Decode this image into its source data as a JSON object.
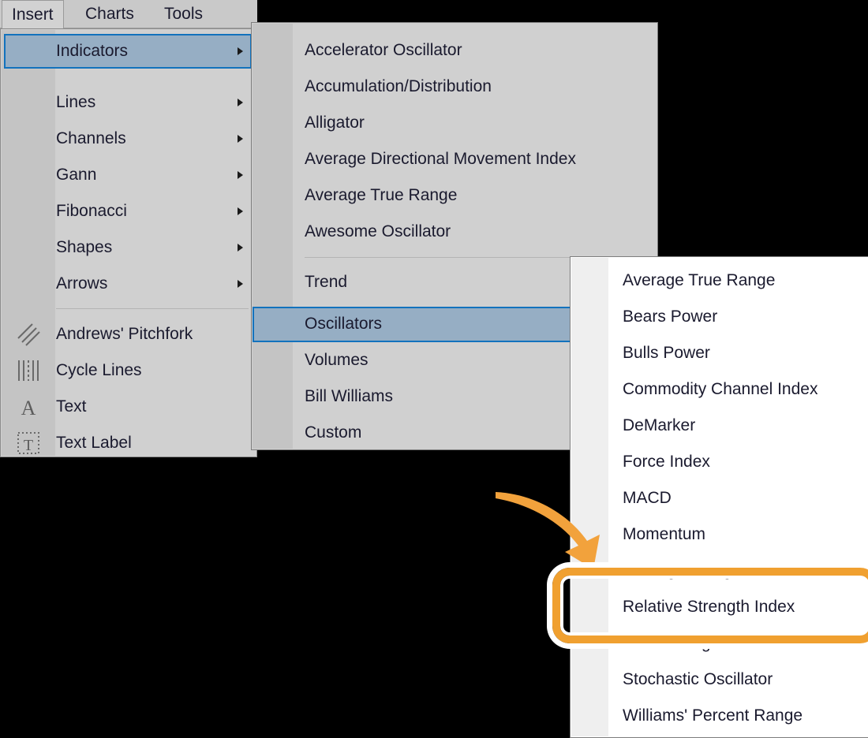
{
  "menubar": {
    "tabs": [
      {
        "label": "Insert",
        "active": true
      },
      {
        "label": "Charts",
        "active": false
      },
      {
        "label": "Tools",
        "active": false
      }
    ]
  },
  "panel_insert": {
    "highlighted_item": "Indicators",
    "items": [
      {
        "label": "Indicators",
        "has_submenu": true,
        "highlighted": true
      },
      {
        "label": "Lines",
        "has_submenu": true
      },
      {
        "label": "Channels",
        "has_submenu": true
      },
      {
        "label": "Gann",
        "has_submenu": true
      },
      {
        "label": "Fibonacci",
        "has_submenu": true
      },
      {
        "label": "Shapes",
        "has_submenu": true
      },
      {
        "label": "Arrows",
        "has_submenu": true
      },
      {
        "label": "Andrews' Pitchfork",
        "icon": "pitchfork-icon"
      },
      {
        "label": "Cycle Lines",
        "icon": "cycle-lines-icon"
      },
      {
        "label": "Text",
        "icon": "text-a-icon"
      },
      {
        "label": "Text Label",
        "icon": "text-label-icon"
      }
    ]
  },
  "panel_indicators": {
    "highlighted_item": "Oscillators",
    "items": [
      {
        "label": "Accelerator Oscillator"
      },
      {
        "label": "Accumulation/Distribution"
      },
      {
        "label": "Alligator"
      },
      {
        "label": "Average Directional Movement Index"
      },
      {
        "label": "Average True Range"
      },
      {
        "label": "Awesome Oscillator"
      },
      {
        "label": "Trend"
      },
      {
        "label": "Oscillators",
        "highlighted": true
      },
      {
        "label": "Volumes"
      },
      {
        "label": "Bill Williams"
      },
      {
        "label": "Custom"
      }
    ]
  },
  "panel_oscillators": {
    "target_item": "Relative Strength Index",
    "items": [
      {
        "label": "Average True Range"
      },
      {
        "label": "Bears Power"
      },
      {
        "label": "Bulls Power"
      },
      {
        "label": "Commodity Channel Index"
      },
      {
        "label": "DeMarker"
      },
      {
        "label": "Force Index"
      },
      {
        "label": "MACD"
      },
      {
        "label": "Momentum"
      },
      {
        "label": "Moving Average of Oscillator"
      },
      {
        "label": "Relative Strength Index",
        "target": true
      },
      {
        "label": "Relative Vigor Index"
      },
      {
        "label": "Stochastic Oscillator"
      },
      {
        "label": "Williams' Percent Range"
      }
    ]
  },
  "annotations": {
    "highlight_color": "#f0a030",
    "arrow": "curved-arrow-icon",
    "box": "callout-rounded-rect"
  },
  "colors": {
    "menu_background": "#d0d0d0",
    "menu_gutter": "#c4c4c4",
    "selection_fill": "#96aec4",
    "selection_border": "#1272bd",
    "submenu_background": "#ffffff",
    "submenu_gutter": "#efefef",
    "text": "#1a1a2e",
    "desktop": "#000000"
  }
}
